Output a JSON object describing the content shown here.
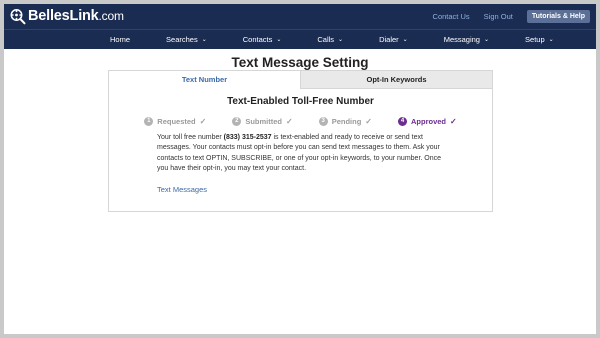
{
  "brand": {
    "name_part1": "Belles",
    "name_part2": "Link",
    "name_suffix": ".com"
  },
  "top_links": {
    "contact": "Contact Us",
    "signout": "Sign Out",
    "help": "Tutorials & Help"
  },
  "nav": [
    {
      "label": "Home",
      "has_chevron": false
    },
    {
      "label": "Searches",
      "has_chevron": true
    },
    {
      "label": "Contacts",
      "has_chevron": true
    },
    {
      "label": "Calls",
      "has_chevron": true
    },
    {
      "label": "Dialer",
      "has_chevron": true
    },
    {
      "label": "Messaging",
      "has_chevron": true
    },
    {
      "label": "Setup",
      "has_chevron": true
    }
  ],
  "page": {
    "title": "Text Message Setting"
  },
  "tabs": [
    {
      "label": "Text Number",
      "active": true
    },
    {
      "label": "Opt-In Keywords",
      "active": false
    }
  ],
  "card": {
    "heading": "Text-Enabled Toll-Free Number",
    "steps": [
      {
        "num": "1",
        "label": "Requested"
      },
      {
        "num": "2",
        "label": "Submitted"
      },
      {
        "num": "3",
        "label": "Pending"
      },
      {
        "num": "4",
        "label": "Approved"
      }
    ],
    "body_prefix": "Your toll free number ",
    "phone": "(833) 315-2537",
    "body_suffix": " is text-enabled and ready to receive or send text messages. Your contacts must opt-in before you can send text messages to them. Ask your contacts to text OPTIN, SUBSCRIBE, or one of your opt-in keywords, to your number. Once you have their opt-in, you may text your contact.",
    "link": "Text Messages"
  },
  "colors": {
    "header_bg": "#1b2c52",
    "link": "#3b6aa8",
    "approved": "#6b2d8f",
    "help_btn": "#5c6f96"
  },
  "icons": {
    "logo": "magnifier-logo-icon",
    "chevron": "chevron-down-icon",
    "check": "check-icon"
  }
}
